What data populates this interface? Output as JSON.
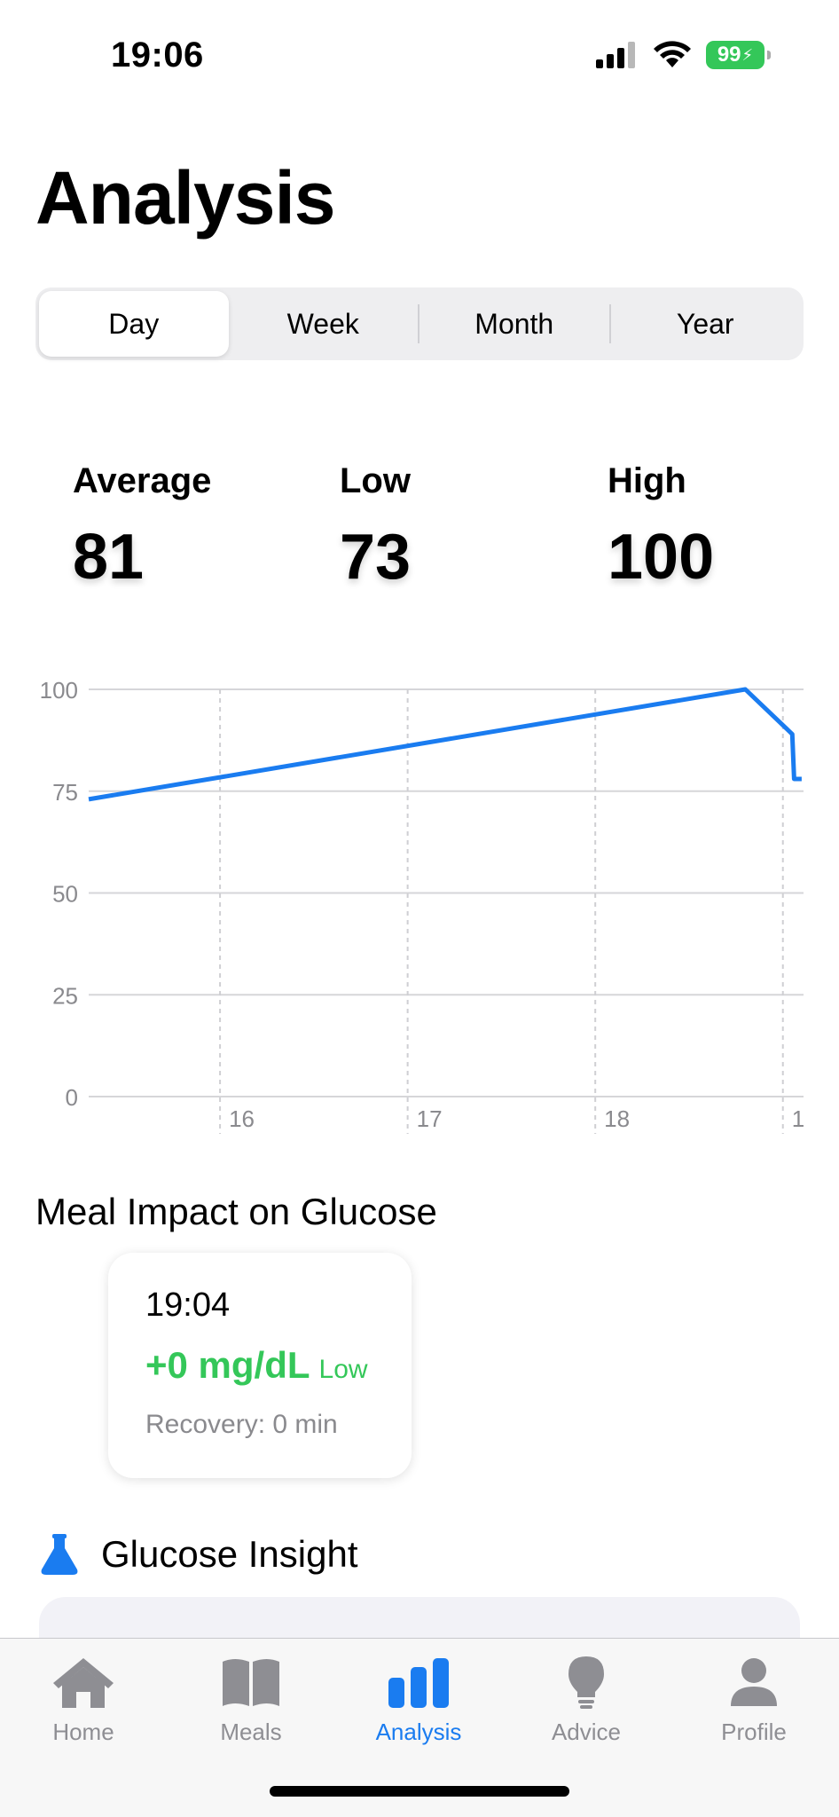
{
  "status_bar": {
    "time": "19:06",
    "battery": "99"
  },
  "page": {
    "title": "Analysis"
  },
  "segments": [
    {
      "label": "Day",
      "active": true
    },
    {
      "label": "Week",
      "active": false
    },
    {
      "label": "Month",
      "active": false
    },
    {
      "label": "Year",
      "active": false
    }
  ],
  "stats": {
    "average": {
      "label": "Average",
      "value": "81"
    },
    "low": {
      "label": "Low",
      "value": "73"
    },
    "high": {
      "label": "High",
      "value": "100"
    }
  },
  "chart_data": {
    "type": "line",
    "x_ticks": [
      "16",
      "17",
      "18",
      "1"
    ],
    "y_ticks": [
      0,
      25,
      50,
      75,
      100
    ],
    "ylim": [
      0,
      100
    ],
    "grid": true,
    "color": "#1a7cf0",
    "series": [
      {
        "points": [
          [
            15.3,
            73
          ],
          [
            18.8,
            100
          ],
          [
            19.05,
            89
          ],
          [
            19.06,
            78
          ],
          [
            19.1,
            78
          ]
        ]
      }
    ]
  },
  "meal_impact": {
    "title": "Meal Impact on Glucose",
    "cards": [
      {
        "time": "19:04",
        "delta": "+0 mg/dL",
        "level": "Low",
        "recovery": "Recovery: 0 min"
      }
    ]
  },
  "insight": {
    "title": "Glucose Insight",
    "icon": "flask-icon"
  },
  "tabs": [
    {
      "label": "Home",
      "icon": "house-icon",
      "active": false
    },
    {
      "label": "Meals",
      "icon": "book-icon",
      "active": false
    },
    {
      "label": "Analysis",
      "icon": "bar-chart-icon",
      "active": true
    },
    {
      "label": "Advice",
      "icon": "lightbulb-icon",
      "active": false
    },
    {
      "label": "Profile",
      "icon": "person-icon",
      "active": false
    }
  ],
  "colors": {
    "accent": "#1a7cf0",
    "positive": "#34c759",
    "battery": "#34c759"
  }
}
